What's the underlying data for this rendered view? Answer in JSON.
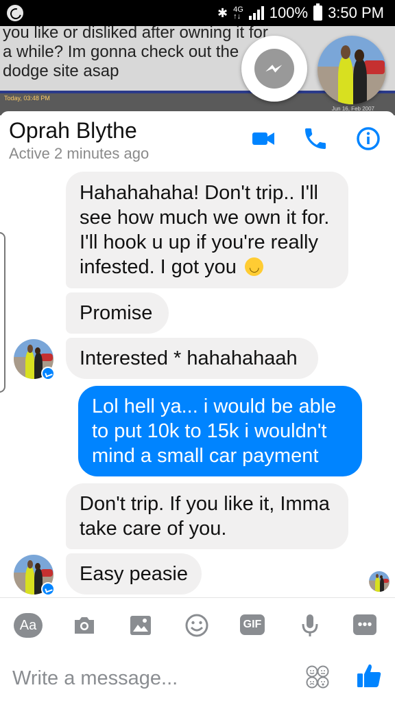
{
  "status_bar": {
    "battery": "100%",
    "time": "3:50 PM",
    "network": "4G"
  },
  "background_app": {
    "partial_text": "you like or disliked after owning it for a while? Im gonna check out the dodge site asap",
    "strip_left": "Today, 03:48 PM",
    "strip_right": "Jun 16, Feb 2007"
  },
  "chat_header": {
    "name": "Oprah Blythe",
    "status": "Active 2 minutes ago"
  },
  "messages": [
    {
      "text": "Hahahahaha! Don't trip.. I'll see how much we own it for. I'll hook u up if you're really infested. I got you",
      "direction": "incoming",
      "emoji": "slightly-smiling-face"
    },
    {
      "text": "Promise",
      "direction": "incoming"
    },
    {
      "text": "Interested * hahahahaah",
      "direction": "incoming"
    },
    {
      "text": "Lol hell ya... i would be able to put 10k to 15k i wouldn't mind a small car payment",
      "direction": "outgoing"
    },
    {
      "text": "Don't trip. If you like it, Imma take care of you.",
      "direction": "incoming"
    },
    {
      "text": "Easy peasie",
      "direction": "incoming"
    }
  ],
  "composer": {
    "aa_label": "Aa",
    "gif_label": "GIF",
    "placeholder": "Write a message..."
  },
  "colors": {
    "accent": "#0084ff",
    "incoming_bubble": "#f1f0f0",
    "icon_gray": "#8a8d91"
  }
}
